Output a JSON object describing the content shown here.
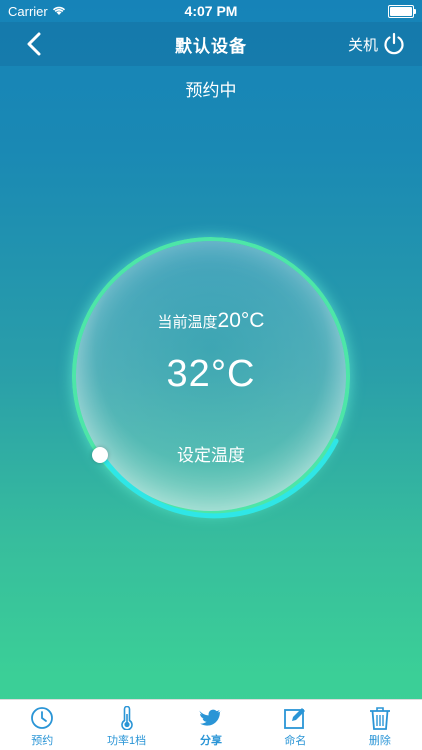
{
  "status_bar": {
    "carrier": "Carrier",
    "time": "4:07 PM"
  },
  "nav": {
    "title": "默认设备",
    "power_label": "关机"
  },
  "schedule_status": "预约中",
  "thermostat": {
    "current_label": "当前温度",
    "current_value": "20°C",
    "set_value": "32°C",
    "set_label": "设定温度"
  },
  "tabs": [
    {
      "label": "预约",
      "icon": "clock-icon"
    },
    {
      "label": "功率1档",
      "icon": "thermometer-icon"
    },
    {
      "label": "分享",
      "icon": "twitter-bird-icon"
    },
    {
      "label": "命名",
      "icon": "edit-icon"
    },
    {
      "label": "删除",
      "icon": "trash-icon"
    }
  ],
  "colors": {
    "accent": "#2a95d6",
    "ring": "#4de6a8",
    "tab_bg": "#ffffff"
  }
}
